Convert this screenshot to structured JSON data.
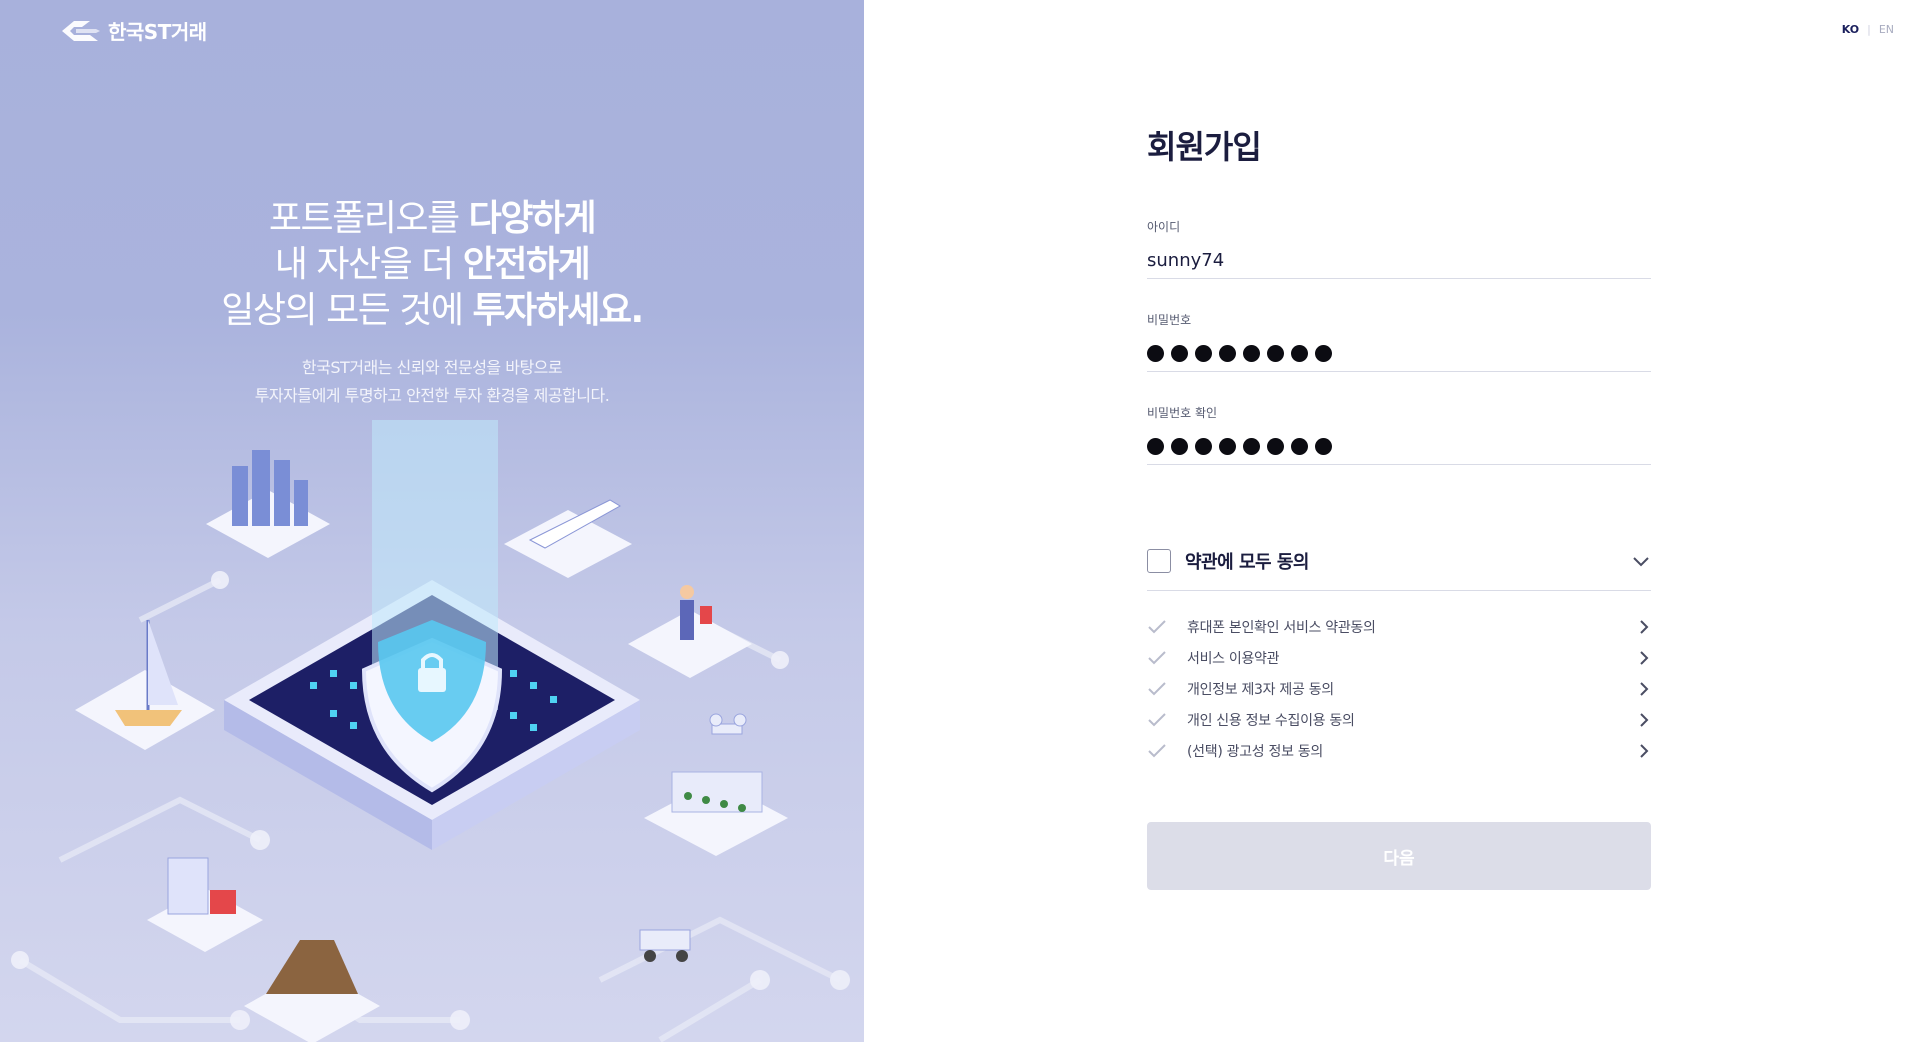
{
  "brand": {
    "name": "한국ST거래",
    "accent": "#1a1f5c"
  },
  "hero": {
    "line1_light": "포트폴리오를 ",
    "line1_bold": "다양하게",
    "line2_light": "내 자산을 더 ",
    "line2_bold": "안전하게",
    "line3_light": "일상의 모든 것에 ",
    "line3_bold": "투자하세요.",
    "sub1": "한국ST거래는 신뢰와 전문성을 바탕으로",
    "sub2": "투자자들에게 투명하고 안전한 투자 환경을 제공합니다."
  },
  "lang": {
    "ko": "KO",
    "sep": "|",
    "en": "EN"
  },
  "form": {
    "title": "회원가입",
    "id_label": "아이디",
    "id_value": "sunny74",
    "pw_label": "비밀번호",
    "pw_confirm_label": "비밀번호 확인",
    "agree_all": "약관에 모두 동의",
    "terms": [
      "휴대폰 본인확인 서비스 약관동의",
      "서비스 이용약관",
      "개인정보 제3자 제공 동의",
      "개인 신용 정보 수집이용 동의",
      "(선택) 광고성 정보 동의"
    ],
    "next": "다음"
  }
}
